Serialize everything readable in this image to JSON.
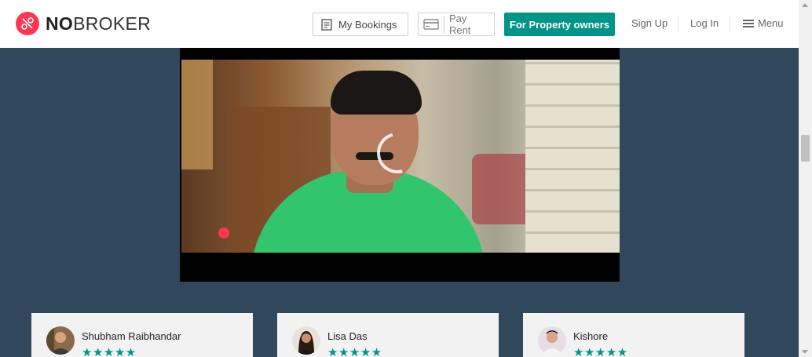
{
  "header": {
    "logo": {
      "bold": "NO",
      "rest": "BROKER",
      "icon": "nobroker-logo-icon"
    },
    "my_bookings": {
      "label": "My Bookings",
      "icon": "bookings-icon"
    },
    "pay_rent": {
      "label": "Pay Rent",
      "icon": "card-icon"
    },
    "cta": {
      "label": "For Property owners",
      "color": "#009587"
    },
    "sign_up": "Sign Up",
    "log_in": "Log In",
    "menu": {
      "label": "Menu",
      "icon": "hamburger-icon"
    }
  },
  "video": {
    "state": "loading",
    "icon": "loading-spinner-icon"
  },
  "reviews": [
    {
      "name": "Shubham Raibhandar",
      "stars": "★★★★★",
      "rating": 5
    },
    {
      "name": "Lisa Das",
      "stars": "★★★★★",
      "rating": 5
    },
    {
      "name": "Kishore",
      "stars": "★★★★★",
      "rating": 5
    }
  ],
  "colors": {
    "accent": "#fd3752",
    "brand_green": "#009587",
    "page_bg": "#31475c"
  }
}
